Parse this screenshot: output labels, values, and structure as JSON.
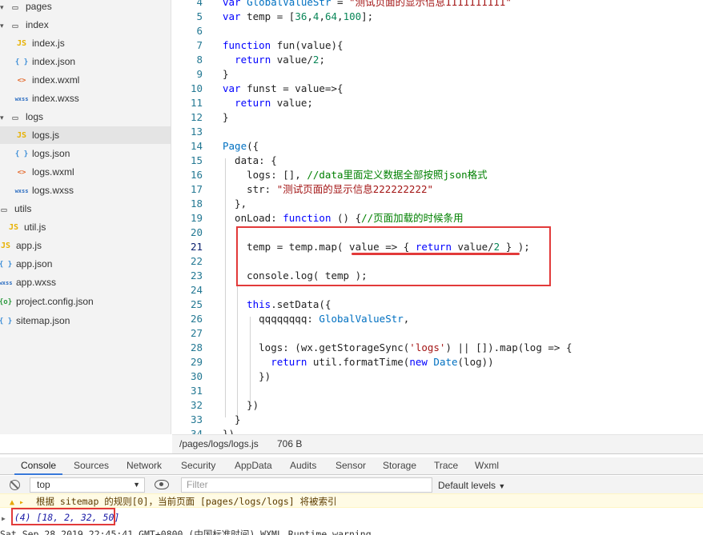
{
  "sidebar": {
    "items": [
      {
        "label": "pages",
        "type": "folder"
      },
      {
        "label": "index",
        "type": "folder"
      },
      {
        "label": "index.js",
        "icon": "JS"
      },
      {
        "label": "index.json",
        "icon": "{}"
      },
      {
        "label": "index.wxml",
        "icon": "<>"
      },
      {
        "label": "index.wxss",
        "icon": "wxss"
      },
      {
        "label": "logs",
        "type": "folder"
      },
      {
        "label": "logs.js",
        "icon": "JS",
        "selected": true
      },
      {
        "label": "logs.json",
        "icon": "{}"
      },
      {
        "label": "logs.wxml",
        "icon": "<>"
      },
      {
        "label": "logs.wxss",
        "icon": "wxss"
      },
      {
        "label": "utils",
        "type": "folder"
      },
      {
        "label": "util.js",
        "icon": "JS"
      },
      {
        "label": "app.js",
        "icon": "JS"
      },
      {
        "label": "app.json",
        "icon": "{}"
      },
      {
        "label": "app.wxss",
        "icon": "wxss"
      },
      {
        "label": "project.config.json",
        "icon": "{o}"
      },
      {
        "label": "sitemap.json",
        "icon": "{}"
      }
    ]
  },
  "editor": {
    "lines": [
      {
        "n": "4",
        "text": "var GlobalValueStr = \"测试页面的显示信息1111111111\""
      },
      {
        "n": "5",
        "text": "var temp = [36,4,64,100];"
      },
      {
        "n": "6",
        "text": ""
      },
      {
        "n": "7",
        "text": "function fun(value){"
      },
      {
        "n": "8",
        "text": "  return value/2;"
      },
      {
        "n": "9",
        "text": "}"
      },
      {
        "n": "10",
        "text": "var funst = value=>{"
      },
      {
        "n": "11",
        "text": "  return value;"
      },
      {
        "n": "12",
        "text": "}"
      },
      {
        "n": "13",
        "text": ""
      },
      {
        "n": "14",
        "text": "Page({"
      },
      {
        "n": "15",
        "text": "  data: {"
      },
      {
        "n": "16",
        "text": "    logs: [], //data里面定义数据全部按照json格式"
      },
      {
        "n": "17",
        "text": "    str: \"测试页面的显示信息222222222\""
      },
      {
        "n": "18",
        "text": "  },"
      },
      {
        "n": "19",
        "text": "  onLoad: function () {//页面加载的时候条用"
      },
      {
        "n": "20",
        "text": ""
      },
      {
        "n": "21",
        "text": "    temp = temp.map( value => { return value/2 } );"
      },
      {
        "n": "22",
        "text": ""
      },
      {
        "n": "23",
        "text": "    console.log( temp );"
      },
      {
        "n": "24",
        "text": ""
      },
      {
        "n": "25",
        "text": "    this.setData({"
      },
      {
        "n": "26",
        "text": "      qqqqqqqq: GlobalValueStr,"
      },
      {
        "n": "27",
        "text": ""
      },
      {
        "n": "28",
        "text": "      logs: (wx.getStorageSync('logs') || []).map(log => {"
      },
      {
        "n": "29",
        "text": "        return util.formatTime(new Date(log))"
      },
      {
        "n": "30",
        "text": "      })"
      },
      {
        "n": "31",
        "text": ""
      },
      {
        "n": "32",
        "text": "    })"
      },
      {
        "n": "33",
        "text": "  }"
      },
      {
        "n": "34",
        "text": "})"
      }
    ],
    "active_line": "21"
  },
  "statusbar": {
    "path": "/pages/logs/logs.js",
    "size": "706 B"
  },
  "devtools": {
    "tabs": [
      "Console",
      "Sources",
      "Network",
      "Security",
      "AppData",
      "Audits",
      "Sensor",
      "Storage",
      "Trace",
      "Wxml"
    ],
    "active_tab": "Console",
    "context_select": "top",
    "filter_placeholder": "Filter",
    "levels_label": "Default levels",
    "console": {
      "warning": "根据 sitemap 的规则[0]，当前页面 [pages/logs/logs] 将被索引",
      "output": "(4) [18, 2, 32, 50]",
      "last": "Sat Sep 28 2019 22:45:41 GMT+0800 (中国标准时间) WXML Runtime warning"
    }
  },
  "colors": {
    "annotation_red": "#e23a3a",
    "active_tab_underline": "#3879d9"
  }
}
